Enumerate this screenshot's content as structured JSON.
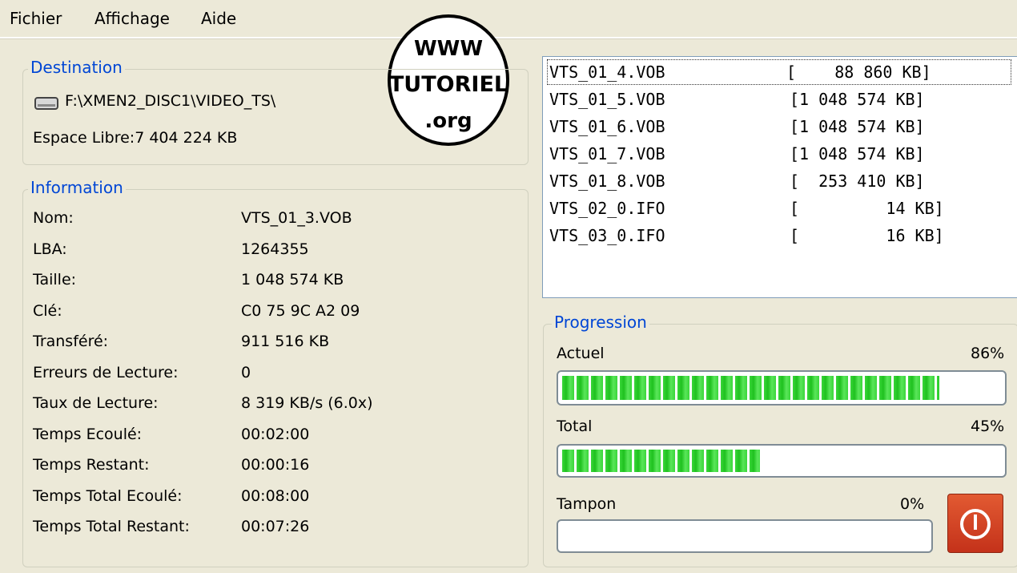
{
  "menu": [
    "Fichier",
    "Affichage",
    "Aide"
  ],
  "logo": {
    "line1": "WWW",
    "line2": "TUTORIEL",
    "line3": ".org"
  },
  "destination": {
    "legend": "Destination",
    "path": "F:\\XMEN2_DISC1\\VIDEO_TS\\",
    "free_space": "Espace Libre:7 404 224 KB",
    "drive_icon": "drive-icon"
  },
  "information": {
    "legend": "Information",
    "rows": [
      {
        "label": "Nom:",
        "value": "VTS_01_3.VOB"
      },
      {
        "label": "LBA:",
        "value": "1264355"
      },
      {
        "label": "Taille:",
        "value": "1 048 574 KB"
      },
      {
        "label": "Clé:",
        "value": "C0 75 9C A2 09"
      },
      {
        "label": "Transféré:",
        "value": "911 516 KB"
      },
      {
        "label": "Erreurs de Lecture:",
        "value": "0"
      },
      {
        "label": "Taux de Lecture:",
        "value": "8 319 KB/s (6.0x)"
      },
      {
        "label": "Temps Ecoulé:",
        "value": "00:02:00"
      },
      {
        "label": "Temps Restant:",
        "value": "00:00:16"
      },
      {
        "label": "Temps Total Ecoulé:",
        "value": "00:08:00"
      },
      {
        "label": "Temps Total Restant:",
        "value": "00:07:26"
      }
    ]
  },
  "files": [
    {
      "name": "VTS_01_4.VOB",
      "size": "[    88 860 KB]"
    },
    {
      "name": "VTS_01_5.VOB",
      "size": "[1 048 574 KB]"
    },
    {
      "name": "VTS_01_6.VOB",
      "size": "[1 048 574 KB]"
    },
    {
      "name": "VTS_01_7.VOB",
      "size": "[1 048 574 KB]"
    },
    {
      "name": "VTS_01_8.VOB",
      "size": "[  253 410 KB]"
    },
    {
      "name": "VTS_02_0.IFO",
      "size": "[         14 KB]"
    },
    {
      "name": "VTS_03_0.IFO",
      "size": "[         16 KB]"
    }
  ],
  "progression": {
    "legend": "Progression",
    "bars": [
      {
        "label": "Actuel",
        "percent_text": "86%",
        "value": 0.86
      },
      {
        "label": "Total",
        "percent_text": "45%",
        "value": 0.45
      },
      {
        "label": "Tampon",
        "percent_text": "0%",
        "value": 0.0
      }
    ]
  },
  "colors": {
    "accent": "#0046d5",
    "progress": "#2ecc2e",
    "stop": "#d9441f"
  },
  "icons": {
    "stop": "power-icon"
  }
}
